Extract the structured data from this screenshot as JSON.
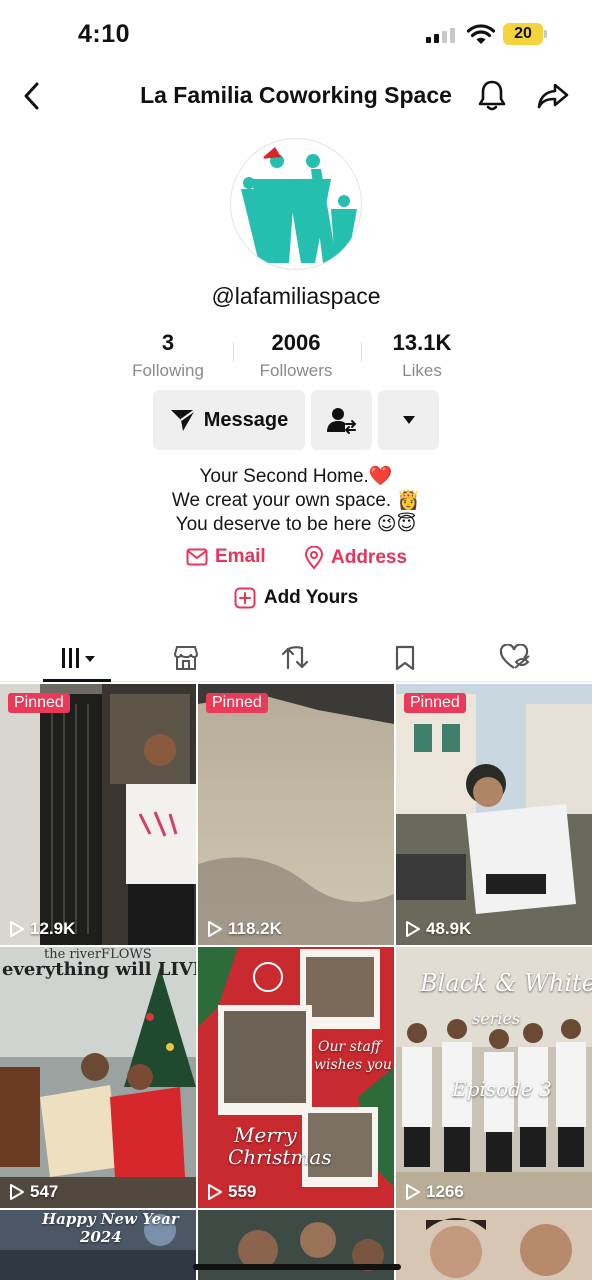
{
  "status_bar": {
    "time": "4:10",
    "battery": "20"
  },
  "header": {
    "title": "La Familia Coworking Space"
  },
  "profile": {
    "username": "@lafamiliaspace"
  },
  "stats": [
    {
      "value": "3",
      "label": "Following"
    },
    {
      "value": "2006",
      "label": "Followers"
    },
    {
      "value": "13.1K",
      "label": "Likes"
    }
  ],
  "actions": {
    "message_label": "Message"
  },
  "bio": {
    "lines": [
      "Your Second Home.❤️",
      "We creat your own space. 👸",
      "You deserve to be here 😉😇"
    ]
  },
  "links": {
    "email": "Email",
    "address": "Address"
  },
  "add_yours": "Add Yours",
  "tabs": [
    "videos",
    "shop",
    "reposts",
    "saved",
    "liked"
  ],
  "videos": [
    {
      "pinned": "Pinned",
      "views": "12.9K"
    },
    {
      "pinned": "Pinned",
      "views": "118.2K"
    },
    {
      "pinned": "Pinned",
      "views": "48.9K"
    },
    {
      "views": "547",
      "overlay_top": "the riverFLOWS",
      "overlay_mid": "everything will LIVE"
    },
    {
      "views": "559",
      "overlay_a": "Our staff",
      "overlay_b": "wishes you",
      "overlay_c": "Merry",
      "overlay_d": "Christmas"
    },
    {
      "views": "1266",
      "overlay_a": "Black & White",
      "overlay_b": "series",
      "overlay_c": "Episode 3"
    },
    {
      "overlay_a": "Happy New Year",
      "overlay_b": "2024"
    },
    {},
    {}
  ],
  "colors": {
    "accent": "#e8345a",
    "brand_teal": "#24bfae",
    "pinned_badge": "#ea3a5a"
  }
}
